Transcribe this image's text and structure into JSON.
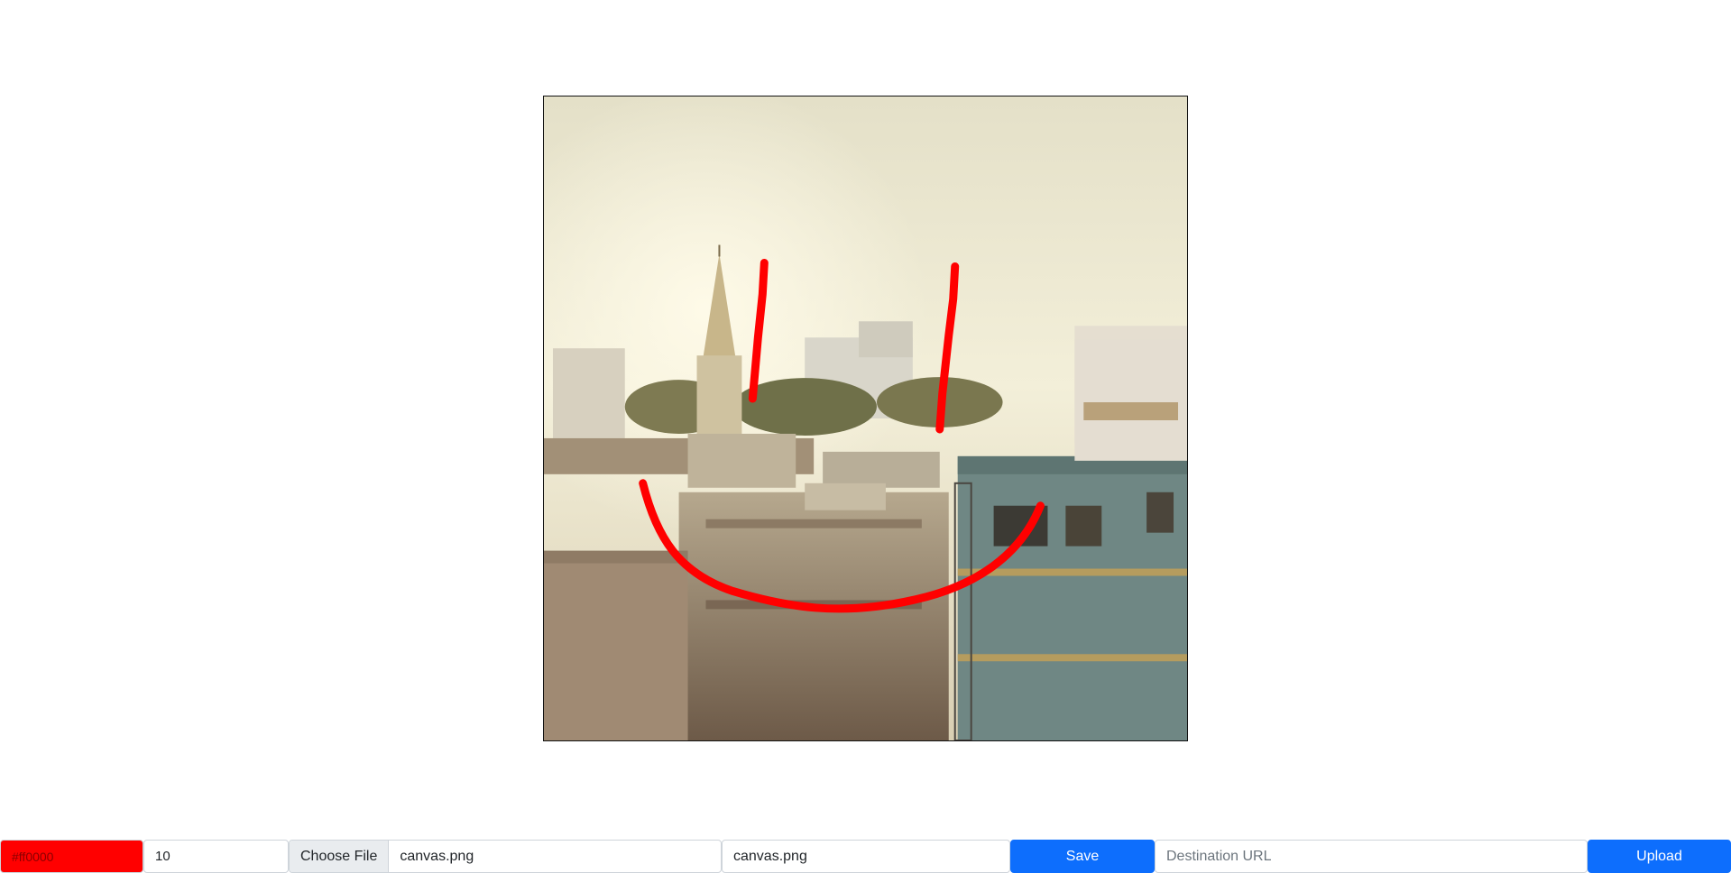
{
  "canvas": {
    "image_description_icon": "city-photo",
    "stroke_color": "#ff0000"
  },
  "toolbar": {
    "color_value": "#ff0000",
    "brush_size": "10",
    "file_button_label": "Choose File",
    "file_chosen_name": "canvas.png",
    "filename_value": "canvas.png",
    "save_label": "Save",
    "url_placeholder": "Destination URL",
    "upload_label": "Upload"
  },
  "colors": {
    "primary": "#0d6efd",
    "brush": "#ff0000"
  }
}
